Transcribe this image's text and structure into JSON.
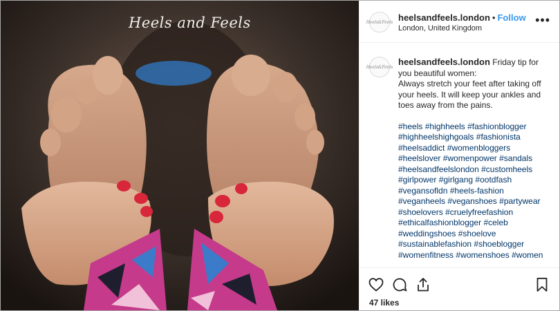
{
  "photo": {
    "watermark": "Heels and Feels"
  },
  "post": {
    "username": "heelsandfeels.london",
    "follow_label": "Follow",
    "separator": "•",
    "location": "London, United Kingdom",
    "more_label": "•••",
    "avatar_text": "Heels&Feels"
  },
  "caption": {
    "username": "heelsandfeels.london",
    "body": "Friday tip for you beautiful women:\nAlways stretch your feet after taking off your heels. It will keep your ankles and toes away from the pains.",
    "hashtags": [
      "#heels",
      "#highheels",
      "#fashionblogger",
      "#highheelshighgoals",
      "#fashionista",
      "#heelsaddict",
      "#womenbloggers",
      "#heelslover",
      "#womenpower",
      "#sandals",
      "#heelsandfeelslondon",
      "#customheels",
      "#girlpower",
      "#girlgang",
      "#ootdfash",
      "#vegansofldn",
      "#heels-fashion",
      "#veganheels",
      "#veganshoes",
      "#partywear",
      "#shoelovers",
      "#cruelyfreefashion",
      "#ethicalfashionblogger",
      "#celeb",
      "#weddingshoes",
      "#shoelove",
      "#sustainablefashion",
      "#shoeblogger",
      "#womenfitness",
      "#womenshoes",
      "#women"
    ]
  },
  "footer": {
    "likes": "47 likes",
    "icons": [
      "heart-icon",
      "comment-icon",
      "share-icon",
      "bookmark-icon"
    ]
  },
  "colors": {
    "accent": "#3897f0",
    "hashtag": "#003569",
    "text": "#262626",
    "border": "#efefef",
    "nail_polish": "#d8263a"
  }
}
